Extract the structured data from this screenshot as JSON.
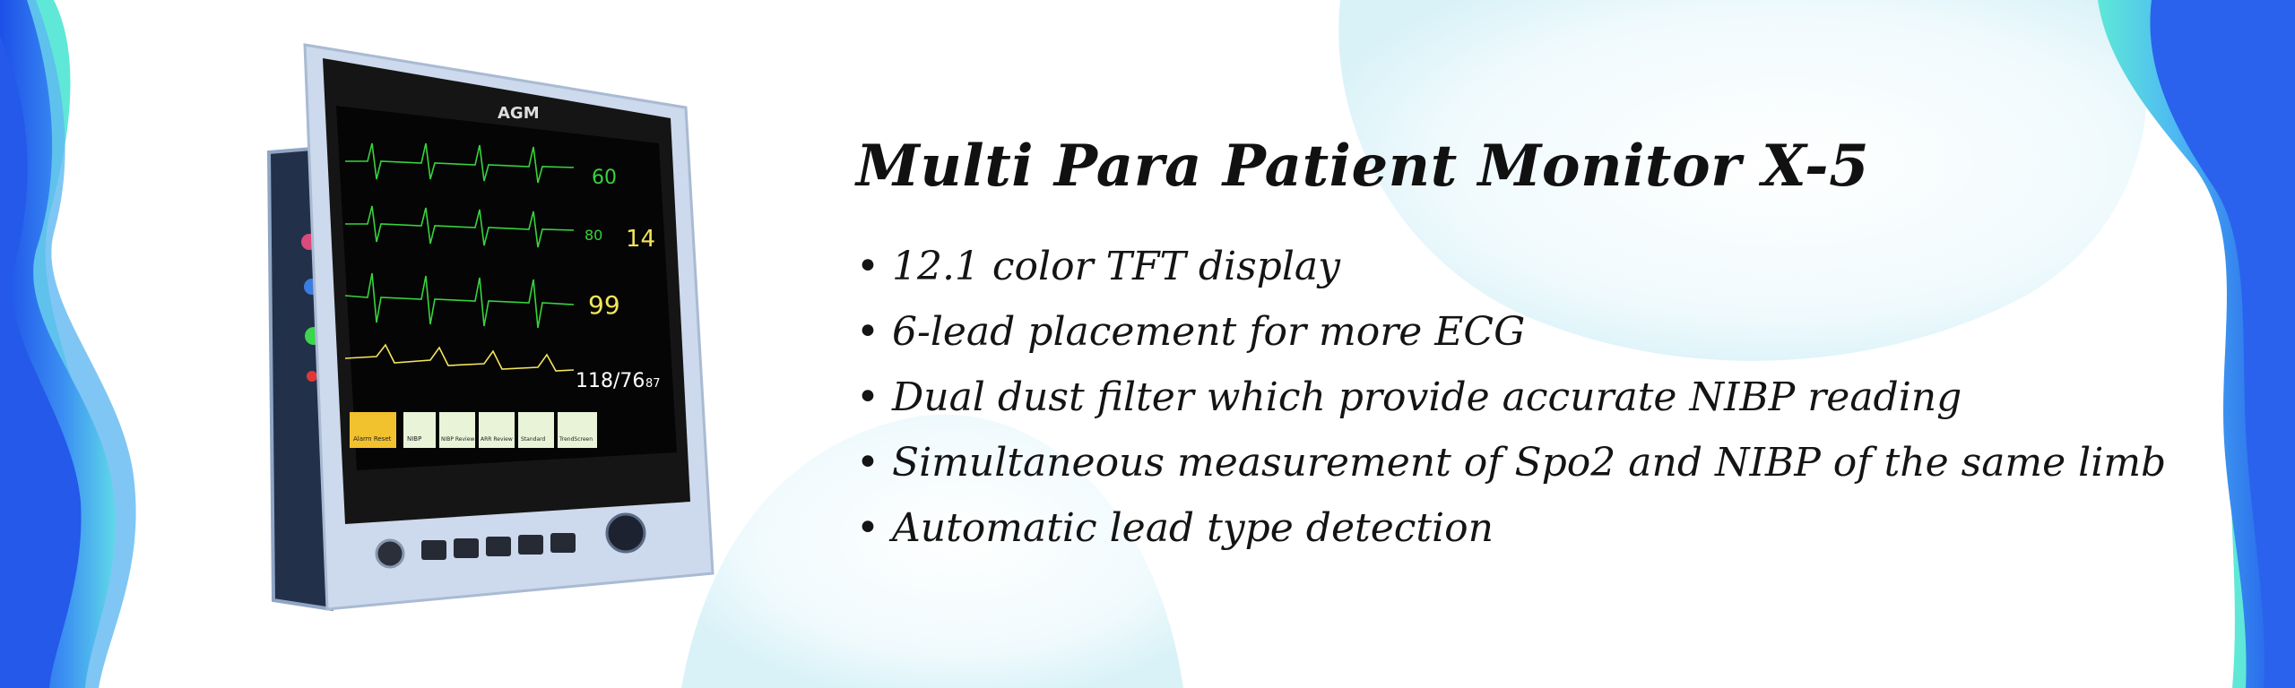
{
  "product": {
    "title": "Multi Para Patient Monitor X-5",
    "features": [
      "12.1 color TFT display",
      "6-lead placement for more ECG",
      "Dual dust filter which provide accurate NIBP reading",
      "Simultaneous measurement of Spo2 and NIBP of the same limb",
      "Automatic lead type detection"
    ],
    "bullet": "•"
  },
  "device": {
    "brand": "AGM",
    "screen_values": {
      "heart_rate": "60",
      "resp": "80",
      "resp_value": "14",
      "spo2": "99",
      "nibp": "118/76",
      "nibp_mean": "87"
    },
    "softkeys": [
      "Alarm Reset",
      "NIBP",
      "NIBP Review",
      "ARR Review",
      "Standard",
      "TrendScreen"
    ]
  },
  "colors": {
    "blue_wave": "#2f6bf0",
    "light_blue_wave": "#5fb2f5",
    "aqua_wave": "#5fe8d8",
    "pale_blob": "#e9f7fb",
    "monitor_frame": "#c9d6ea",
    "screen_bg": "#0a0a0a",
    "ecg_green": "#37d33c",
    "spo2_yellow": "#f3e45c",
    "softkey_yellow": "#f2c12e"
  },
  "icons": [
    "device-image",
    "wave-decoration"
  ]
}
